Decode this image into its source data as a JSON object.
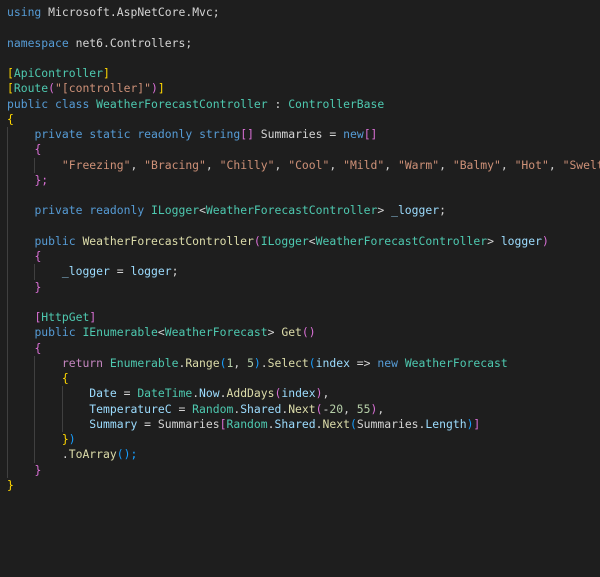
{
  "colors": {
    "background": "#1e1e1e",
    "keyword": "#569cd6",
    "control": "#c586c0",
    "type": "#4ec9b0",
    "method": "#dcdcaa",
    "string": "#ce9178",
    "number": "#b5cea8",
    "variable": "#9cdcfe",
    "plain": "#d4d4d4",
    "bracket_gold": "#ffd700",
    "bracket_purple": "#da70d6",
    "bracket_blue": "#179fff"
  },
  "code_lines": [
    [
      [
        "using",
        "keyword"
      ],
      [
        " ",
        "plain"
      ],
      [
        "Microsoft",
        "plain"
      ],
      [
        ".",
        "plain"
      ],
      [
        "AspNetCore",
        "plain"
      ],
      [
        ".",
        "plain"
      ],
      [
        "Mvc",
        "plain"
      ],
      [
        ";",
        "plain"
      ]
    ],
    [],
    [
      [
        "namespace",
        "keyword"
      ],
      [
        " ",
        "plain"
      ],
      [
        "net6",
        "plain"
      ],
      [
        ".",
        "plain"
      ],
      [
        "Controllers",
        "plain"
      ],
      [
        ";",
        "plain"
      ]
    ],
    [],
    [
      [
        "[",
        "bracket_gold"
      ],
      [
        "ApiController",
        "type"
      ],
      [
        "]",
        "bracket_gold"
      ]
    ],
    [
      [
        "[",
        "bracket_gold"
      ],
      [
        "Route",
        "type"
      ],
      [
        "(",
        "bracket_purple"
      ],
      [
        "\"[controller]\"",
        "string"
      ],
      [
        ")",
        "bracket_purple"
      ],
      [
        "]",
        "bracket_gold"
      ]
    ],
    [
      [
        "public",
        "keyword"
      ],
      [
        " ",
        "plain"
      ],
      [
        "class",
        "keyword"
      ],
      [
        " ",
        "plain"
      ],
      [
        "WeatherForecastController",
        "type"
      ],
      [
        " : ",
        "plain"
      ],
      [
        "ControllerBase",
        "type"
      ]
    ],
    [
      [
        "{",
        "bracket_gold"
      ]
    ],
    [
      [
        "    ",
        "plain"
      ],
      [
        "private",
        "keyword"
      ],
      [
        " ",
        "plain"
      ],
      [
        "static",
        "keyword"
      ],
      [
        " ",
        "plain"
      ],
      [
        "readonly",
        "keyword"
      ],
      [
        " ",
        "plain"
      ],
      [
        "string",
        "keyword"
      ],
      [
        "[]",
        "bracket_purple"
      ],
      [
        " ",
        "plain"
      ],
      [
        "Summaries",
        "plain"
      ],
      [
        " = ",
        "plain"
      ],
      [
        "new",
        "keyword"
      ],
      [
        "[]",
        "bracket_purple"
      ]
    ],
    [
      [
        "    ",
        "plain"
      ],
      [
        "{",
        "bracket_purple"
      ]
    ],
    [
      [
        "        ",
        "plain"
      ],
      [
        "\"Freezing\"",
        "string"
      ],
      [
        ", ",
        "plain"
      ],
      [
        "\"Bracing\"",
        "string"
      ],
      [
        ", ",
        "plain"
      ],
      [
        "\"Chilly\"",
        "string"
      ],
      [
        ", ",
        "plain"
      ],
      [
        "\"Cool\"",
        "string"
      ],
      [
        ", ",
        "plain"
      ],
      [
        "\"Mild\"",
        "string"
      ],
      [
        ", ",
        "plain"
      ],
      [
        "\"Warm\"",
        "string"
      ],
      [
        ", ",
        "plain"
      ],
      [
        "\"Balmy\"",
        "string"
      ],
      [
        ", ",
        "plain"
      ],
      [
        "\"Hot\"",
        "string"
      ],
      [
        ", ",
        "plain"
      ],
      [
        "\"Sweltering\"",
        "string"
      ],
      [
        ", ",
        "plain"
      ],
      [
        "\"",
        "string"
      ]
    ],
    [
      [
        "    ",
        "plain"
      ],
      [
        "};",
        "bracket_purple"
      ]
    ],
    [],
    [
      [
        "    ",
        "plain"
      ],
      [
        "private",
        "keyword"
      ],
      [
        " ",
        "plain"
      ],
      [
        "readonly",
        "keyword"
      ],
      [
        " ",
        "plain"
      ],
      [
        "ILogger",
        "type"
      ],
      [
        "<",
        "plain"
      ],
      [
        "WeatherForecastController",
        "type"
      ],
      [
        ">",
        "plain"
      ],
      [
        " ",
        "plain"
      ],
      [
        "_logger",
        "variable"
      ],
      [
        ";",
        "plain"
      ]
    ],
    [],
    [
      [
        "    ",
        "plain"
      ],
      [
        "public",
        "keyword"
      ],
      [
        " ",
        "plain"
      ],
      [
        "WeatherForecastController",
        "method"
      ],
      [
        "(",
        "bracket_purple"
      ],
      [
        "ILogger",
        "type"
      ],
      [
        "<",
        "plain"
      ],
      [
        "WeatherForecastController",
        "type"
      ],
      [
        ">",
        "plain"
      ],
      [
        " ",
        "plain"
      ],
      [
        "logger",
        "variable"
      ],
      [
        ")",
        "bracket_purple"
      ]
    ],
    [
      [
        "    ",
        "plain"
      ],
      [
        "{",
        "bracket_purple"
      ]
    ],
    [
      [
        "        ",
        "plain"
      ],
      [
        "_logger",
        "variable"
      ],
      [
        " = ",
        "plain"
      ],
      [
        "logger",
        "variable"
      ],
      [
        ";",
        "plain"
      ]
    ],
    [
      [
        "    ",
        "plain"
      ],
      [
        "}",
        "bracket_purple"
      ]
    ],
    [],
    [
      [
        "    ",
        "plain"
      ],
      [
        "[",
        "bracket_purple"
      ],
      [
        "HttpGet",
        "type"
      ],
      [
        "]",
        "bracket_purple"
      ]
    ],
    [
      [
        "    ",
        "plain"
      ],
      [
        "public",
        "keyword"
      ],
      [
        " ",
        "plain"
      ],
      [
        "IEnumerable",
        "type"
      ],
      [
        "<",
        "plain"
      ],
      [
        "WeatherForecast",
        "type"
      ],
      [
        ">",
        "plain"
      ],
      [
        " ",
        "plain"
      ],
      [
        "Get",
        "method"
      ],
      [
        "()",
        "bracket_purple"
      ]
    ],
    [
      [
        "    ",
        "plain"
      ],
      [
        "{",
        "bracket_purple"
      ]
    ],
    [
      [
        "        ",
        "plain"
      ],
      [
        "return",
        "control"
      ],
      [
        " ",
        "plain"
      ],
      [
        "Enumerable",
        "type"
      ],
      [
        ".",
        "plain"
      ],
      [
        "Range",
        "method"
      ],
      [
        "(",
        "bracket_blue"
      ],
      [
        "1",
        "number"
      ],
      [
        ", ",
        "plain"
      ],
      [
        "5",
        "number"
      ],
      [
        ")",
        "bracket_blue"
      ],
      [
        ".",
        "plain"
      ],
      [
        "Select",
        "method"
      ],
      [
        "(",
        "bracket_blue"
      ],
      [
        "index",
        "variable"
      ],
      [
        " => ",
        "plain"
      ],
      [
        "new",
        "keyword"
      ],
      [
        " ",
        "plain"
      ],
      [
        "WeatherForecast",
        "type"
      ]
    ],
    [
      [
        "        ",
        "plain"
      ],
      [
        "{",
        "bracket_gold"
      ]
    ],
    [
      [
        "            ",
        "plain"
      ],
      [
        "Date",
        "variable"
      ],
      [
        " = ",
        "plain"
      ],
      [
        "DateTime",
        "type"
      ],
      [
        ".",
        "plain"
      ],
      [
        "Now",
        "variable"
      ],
      [
        ".",
        "plain"
      ],
      [
        "AddDays",
        "method"
      ],
      [
        "(",
        "bracket_purple"
      ],
      [
        "index",
        "variable"
      ],
      [
        ")",
        "bracket_purple"
      ],
      [
        ",",
        "plain"
      ]
    ],
    [
      [
        "            ",
        "plain"
      ],
      [
        "TemperatureC",
        "variable"
      ],
      [
        " = ",
        "plain"
      ],
      [
        "Random",
        "type"
      ],
      [
        ".",
        "plain"
      ],
      [
        "Shared",
        "variable"
      ],
      [
        ".",
        "plain"
      ],
      [
        "Next",
        "method"
      ],
      [
        "(",
        "bracket_purple"
      ],
      [
        "-",
        "plain"
      ],
      [
        "20",
        "number"
      ],
      [
        ", ",
        "plain"
      ],
      [
        "55",
        "number"
      ],
      [
        ")",
        "bracket_purple"
      ],
      [
        ",",
        "plain"
      ]
    ],
    [
      [
        "            ",
        "plain"
      ],
      [
        "Summary",
        "variable"
      ],
      [
        " = ",
        "plain"
      ],
      [
        "Summaries",
        "plain"
      ],
      [
        "[",
        "bracket_purple"
      ],
      [
        "Random",
        "type"
      ],
      [
        ".",
        "plain"
      ],
      [
        "Shared",
        "variable"
      ],
      [
        ".",
        "plain"
      ],
      [
        "Next",
        "method"
      ],
      [
        "(",
        "bracket_blue"
      ],
      [
        "Summaries",
        "plain"
      ],
      [
        ".",
        "plain"
      ],
      [
        "Length",
        "variable"
      ],
      [
        ")",
        "bracket_blue"
      ],
      [
        "]",
        "bracket_purple"
      ]
    ],
    [
      [
        "        ",
        "plain"
      ],
      [
        "}",
        "bracket_gold"
      ],
      [
        ")",
        "bracket_blue"
      ]
    ],
    [
      [
        "        ",
        "plain"
      ],
      [
        ".",
        "plain"
      ],
      [
        "ToArray",
        "method"
      ],
      [
        "();",
        "bracket_blue"
      ]
    ],
    [
      [
        "    ",
        "plain"
      ],
      [
        "}",
        "bracket_purple"
      ]
    ],
    [
      [
        "}",
        "bracket_gold"
      ]
    ]
  ]
}
